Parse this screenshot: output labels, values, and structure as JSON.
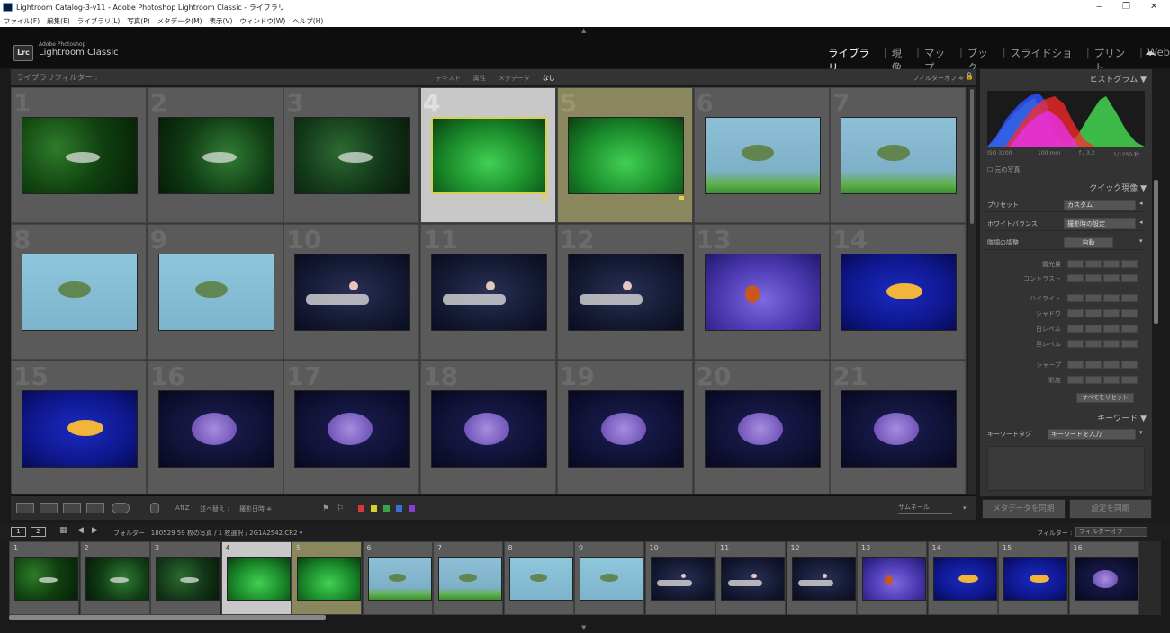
{
  "window": {
    "title": "Lightroom Catalog-3-v11 - Adobe Photoshop Lightroom Classic - ライブラリ",
    "minimize": "‒",
    "restore": "❐",
    "close": "✕"
  },
  "menu": [
    "ファイル(F)",
    "編集(E)",
    "ライブラリ(L)",
    "写真(P)",
    "メタデータ(M)",
    "表示(V)",
    "ウィンドウ(W)",
    "ヘルプ(H)"
  ],
  "brand": {
    "logo": "Lrc",
    "line1": "Adobe Photoshop",
    "line2": "Lightroom Classic"
  },
  "modules": {
    "items": [
      "ライブラリ",
      "現像",
      "マップ",
      "ブック",
      "スライドショー",
      "プリント",
      "Web"
    ],
    "active": "ライブラリ",
    "separator": "|"
  },
  "filterbar": {
    "title": "ライブラリフィルター :",
    "tabs": [
      "テキスト",
      "属性",
      "メタデータ",
      "なし"
    ],
    "active_tab": "なし",
    "filter_off": "フィルターオフ ≑"
  },
  "grid": {
    "columns": 7,
    "cells": [
      {
        "num": "1",
        "photo": "plant1",
        "state": ""
      },
      {
        "num": "2",
        "photo": "plant2",
        "state": ""
      },
      {
        "num": "3",
        "photo": "plant3",
        "state": ""
      },
      {
        "num": "4",
        "photo": "green",
        "state": "sel"
      },
      {
        "num": "5",
        "photo": "green",
        "state": "sel2"
      },
      {
        "num": "6",
        "photo": "blue",
        "state": ""
      },
      {
        "num": "7",
        "photo": "blue",
        "state": ""
      },
      {
        "num": "8",
        "photo": "blue2",
        "state": ""
      },
      {
        "num": "9",
        "photo": "blue2",
        "state": ""
      },
      {
        "num": "10",
        "photo": "jelly",
        "state": ""
      },
      {
        "num": "11",
        "photo": "jelly",
        "state": ""
      },
      {
        "num": "12",
        "photo": "jelly",
        "state": ""
      },
      {
        "num": "13",
        "photo": "coral",
        "state": ""
      },
      {
        "num": "14",
        "photo": "deep",
        "state": ""
      },
      {
        "num": "15",
        "photo": "deep",
        "state": ""
      },
      {
        "num": "16",
        "photo": "navy",
        "state": ""
      },
      {
        "num": "17",
        "photo": "navy",
        "state": ""
      },
      {
        "num": "18",
        "photo": "navy",
        "state": ""
      },
      {
        "num": "19",
        "photo": "navy",
        "state": ""
      },
      {
        "num": "20",
        "photo": "navy",
        "state": ""
      },
      {
        "num": "21",
        "photo": "navy",
        "state": ""
      }
    ]
  },
  "toolbar": {
    "sort_label": "並べ替え :",
    "sort_value": "撮影日時 ≑",
    "thumb_label": "サムネール",
    "label_colors": [
      "#d23b3b",
      "#d8cf2f",
      "#3ba34a",
      "#3b6fd2",
      "#8a3bd2"
    ]
  },
  "panels": {
    "histogram": {
      "title": "ヒストグラム ▼",
      "iso": "ISO 3200",
      "focal": "100 mm",
      "aperture": "f / 3.2",
      "shutter": "1/1250 秒",
      "original": "元の写真"
    },
    "quick_develop": {
      "title": "クイック現像 ▼",
      "rows": [
        {
          "label": "プリセット",
          "value": "カスタム"
        },
        {
          "label": "ホワイトバランス",
          "value": "撮影時の設定"
        },
        {
          "label": "階調の調整",
          "value": "自動"
        }
      ],
      "sliders": [
        "露光量",
        "コントラスト",
        "ハイライト",
        "シャドウ",
        "白レベル",
        "黒レベル",
        "シャープ",
        "彩度"
      ],
      "reset": "すべてをリセット"
    },
    "keywords": {
      "title": "キーワード ▼",
      "row_label": "キーワードタグ",
      "row_value": "キーワードを入力"
    },
    "sync_metadata": "メタデータを同期",
    "sync_settings": "設定を同期"
  },
  "filmstrip_bar": {
    "page1": "1",
    "page2": "2",
    "path": "フォルダー : 180529   59 枚の写真 / 1 枚選択 / 2G1A2542.CR2 ▾",
    "filter_label": "フィルター :",
    "filter_value": "フィルターオフ"
  },
  "filmstrip": {
    "cells": [
      {
        "num": "1",
        "photo": "plant1",
        "state": ""
      },
      {
        "num": "2",
        "photo": "plant2",
        "state": ""
      },
      {
        "num": "3",
        "photo": "plant3",
        "state": ""
      },
      {
        "num": "4",
        "photo": "green",
        "state": "sel"
      },
      {
        "num": "5",
        "photo": "green",
        "state": "sel2"
      },
      {
        "num": "6",
        "photo": "blue",
        "state": ""
      },
      {
        "num": "7",
        "photo": "blue",
        "state": ""
      },
      {
        "num": "8",
        "photo": "blue2",
        "state": ""
      },
      {
        "num": "9",
        "photo": "blue2",
        "state": ""
      },
      {
        "num": "10",
        "photo": "jelly",
        "state": ""
      },
      {
        "num": "11",
        "photo": "jelly",
        "state": ""
      },
      {
        "num": "12",
        "photo": "jelly",
        "state": ""
      },
      {
        "num": "13",
        "photo": "coral",
        "state": ""
      },
      {
        "num": "14",
        "photo": "deep",
        "state": ""
      },
      {
        "num": "15",
        "photo": "deep",
        "state": ""
      },
      {
        "num": "16",
        "photo": "navy",
        "state": ""
      }
    ]
  }
}
